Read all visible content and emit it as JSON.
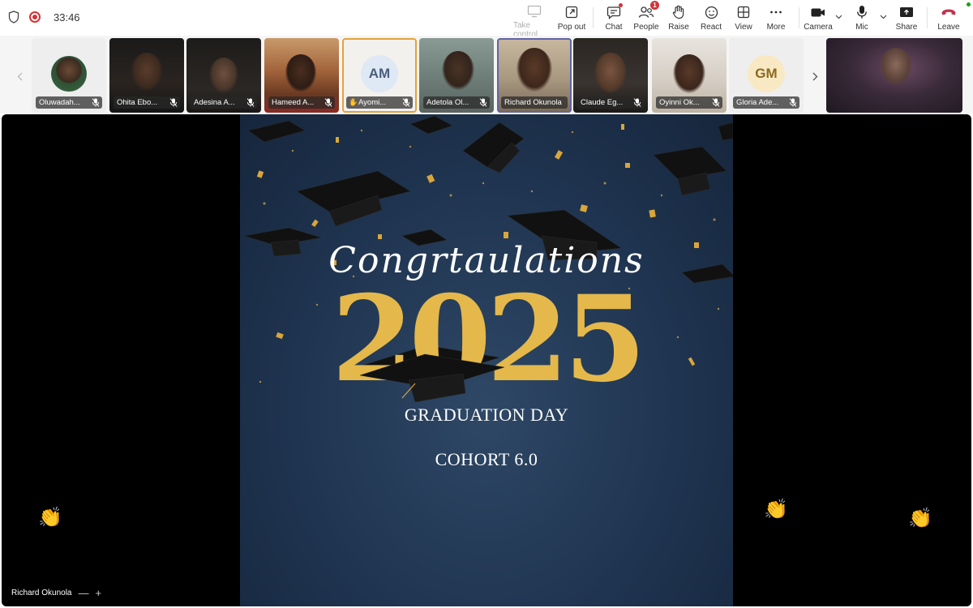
{
  "meeting": {
    "timer": "33:46"
  },
  "toolbar": {
    "take_control": "Take control",
    "pop_out": "Pop out",
    "chat": "Chat",
    "people": "People",
    "people_badge": "1",
    "raise": "Raise",
    "react": "React",
    "view": "View",
    "more": "More",
    "camera": "Camera",
    "mic": "Mic",
    "share": "Share",
    "leave": "Leave"
  },
  "participants": [
    {
      "name": "Oluwadah..."
    },
    {
      "name": "Ohita Ebo..."
    },
    {
      "name": "Adesina A..."
    },
    {
      "name": "Hameed A..."
    },
    {
      "name": "Ayomi...",
      "initials": "AM",
      "hand_raised": true
    },
    {
      "name": "Adetola Ol..."
    },
    {
      "name": "Richard Okunola"
    },
    {
      "name": "Claude Eg..."
    },
    {
      "name": "Oyinni Ok..."
    },
    {
      "name": "Gloria Ade...",
      "initials": "GM"
    }
  ],
  "slide": {
    "script_text": "Congrtaulations",
    "year": "2025",
    "line1": "GRADUATION DAY",
    "line2": "COHORT 6.0"
  },
  "stage": {
    "presenter_name": "Richard Okunola",
    "minus": "—",
    "plus": "+"
  },
  "colors": {
    "accent": "#6264a7",
    "leave": "#c4314b",
    "year_gold": "#e4b84a",
    "slide_bg": "#1f3450"
  }
}
